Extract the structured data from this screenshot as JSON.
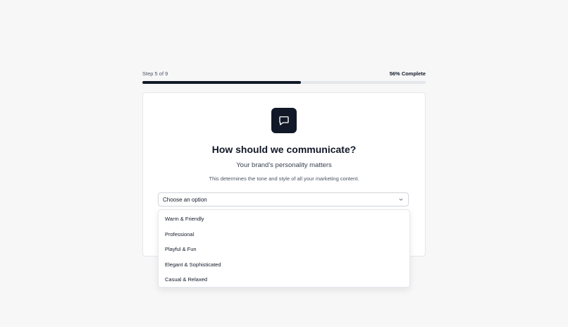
{
  "progress": {
    "step_label": "Step 5 of 9",
    "percent_label": "56% Complete",
    "percent": 56
  },
  "question": {
    "icon": "message-square-icon",
    "title": "How should we communicate?",
    "subtitle": "Your brand's personality matters",
    "description": "This determines the tone and style of all your marketing content."
  },
  "select": {
    "placeholder": "Choose an option",
    "options": [
      "Warm & Friendly",
      "Professional",
      "Playful & Fun",
      "Elegant & Sophisticated",
      "Casual & Relaxed"
    ]
  },
  "colors": {
    "accent": "#111827",
    "track": "#e5e7eb",
    "background": "#f7f7f8"
  }
}
